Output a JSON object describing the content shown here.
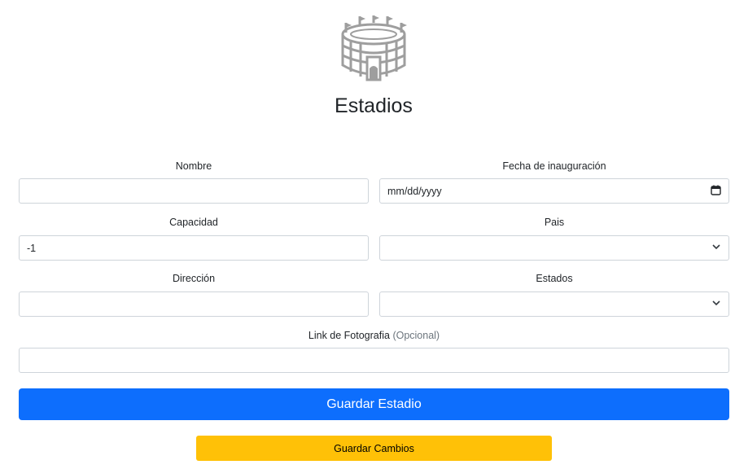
{
  "header": {
    "logo_icon": "stadium-icon",
    "title": "Estadios"
  },
  "form": {
    "nombre": {
      "label": "Nombre",
      "value": ""
    },
    "fecha": {
      "label": "Fecha de inauguración",
      "value": "mm/dd/yyyy",
      "icon": "calendar-icon"
    },
    "capacidad": {
      "label": "Capacidad",
      "value": "-1"
    },
    "pais": {
      "label": "Pais",
      "value": "",
      "icon": "chevron-down-icon"
    },
    "direccion": {
      "label": "Dirección",
      "value": ""
    },
    "estados": {
      "label": "Estados",
      "value": "",
      "icon": "chevron-down-icon"
    },
    "foto": {
      "label": "Link de Fotografia",
      "label_hint": "(Opcional)",
      "value": ""
    }
  },
  "buttons": {
    "save_stadium": "Guardar Estadio",
    "save_changes": "Guardar Cambios"
  },
  "colors": {
    "primary": "#0d6efd",
    "warning": "#ffc107",
    "border": "#ced4da",
    "muted": "#6c757d",
    "icon_gray": "#9e9e9e"
  }
}
